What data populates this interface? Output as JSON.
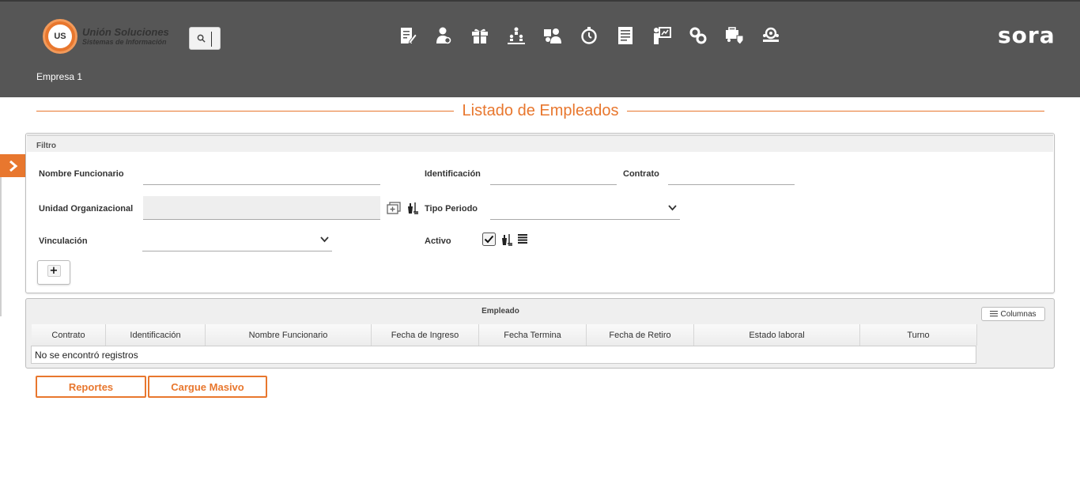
{
  "header": {
    "brand_title": "Unión Soluciones",
    "brand_sub": "Sistemas de Información",
    "brand_mark": "US",
    "app_name": "sora",
    "company": "Empresa 1",
    "modules": [
      "document-edit-icon",
      "user-admin-icon",
      "gift-icon",
      "org-chart-icon",
      "user-group-icon",
      "timer-icon",
      "report-icon",
      "presentation-icon",
      "settings-cogs-icon",
      "shield-truck-icon",
      "group-settings-icon"
    ]
  },
  "page": {
    "title": "Listado de Empleados"
  },
  "filter": {
    "heading": "Filtro",
    "nombre_label": "Nombre Funcionario",
    "nombre_value": "",
    "identificacion_label": "Identificación",
    "identificacion_value": "",
    "contrato_label": "Contrato",
    "contrato_value": "",
    "unidad_label": "Unidad Organizacional",
    "unidad_value": "",
    "tipo_periodo_label": "Tipo Periodo",
    "tipo_periodo_value": "",
    "vinculacion_label": "Vinculación",
    "vinculacion_value": "",
    "activo_label": "Activo",
    "activo_checked": true,
    "add_label": "+"
  },
  "table": {
    "heading": "Empleado",
    "columns_button": "Columnas",
    "columns": [
      "Contrato",
      "Identificación",
      "Nombre Funcionario",
      "Fecha de Ingreso",
      "Fecha Termina",
      "Fecha de Retiro",
      "Estado laboral",
      "Turno"
    ],
    "empty_message": "No se encontró registros"
  },
  "actions": {
    "reportes": "Reportes",
    "cargue": "Cargue Masivo"
  },
  "colors": {
    "accent": "#e8772e",
    "header_bg": "#565656"
  }
}
